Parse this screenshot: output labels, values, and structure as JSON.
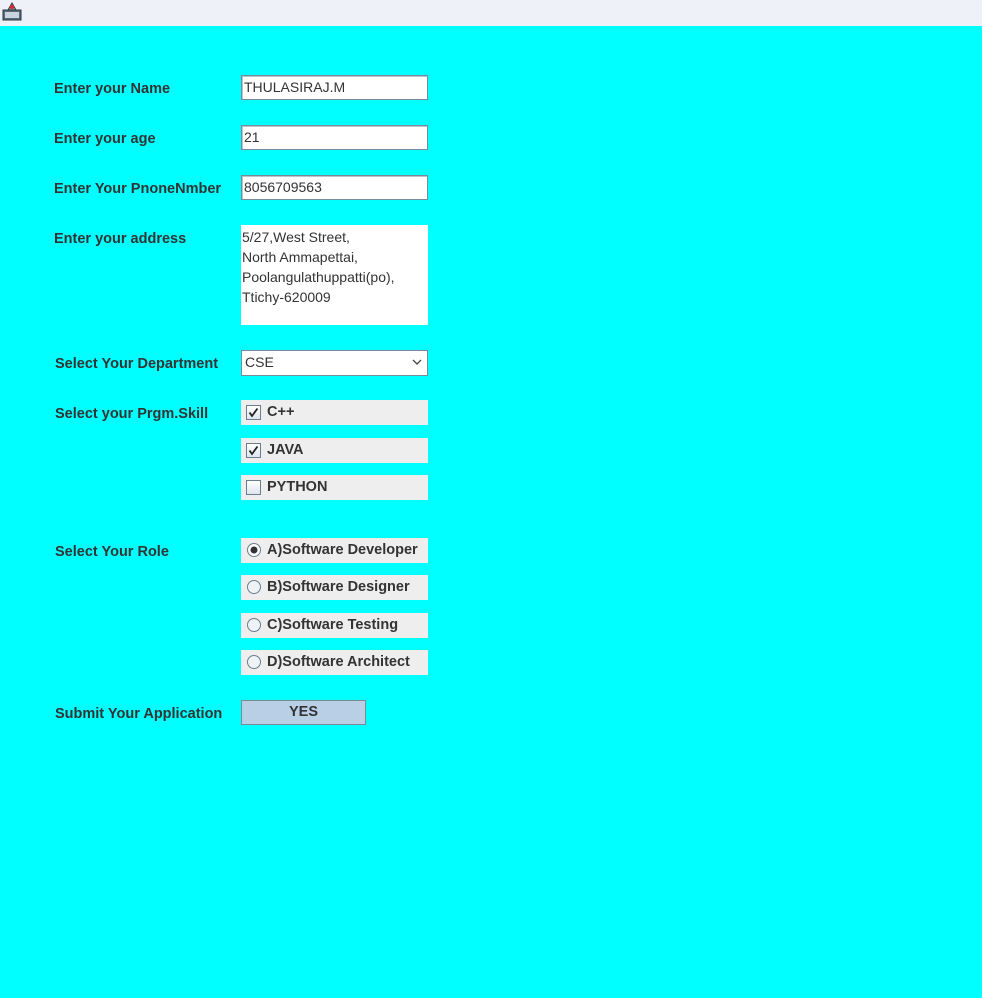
{
  "form": {
    "name": {
      "label": "Enter your Name",
      "value": "THULASIRAJ.M"
    },
    "age": {
      "label": "Enter your age",
      "value": "21"
    },
    "phone": {
      "label": "Enter Your PnoneNmber",
      "value": "8056709563"
    },
    "address": {
      "label": "Enter your address",
      "value": "5/27,West Street,\nNorth Ammapettai,\nPoolangulathuppatti(po),\nTtichy-620009"
    },
    "department": {
      "label": "Select Your Department",
      "value": "CSE"
    },
    "skills": {
      "label": "Select your Prgm.Skill",
      "options": [
        {
          "label": "C++",
          "checked": true
        },
        {
          "label": "JAVA",
          "checked": true
        },
        {
          "label": "PYTHON",
          "checked": false
        }
      ]
    },
    "role": {
      "label": "Select Your Role",
      "options": [
        {
          "label": "A)Software Developer",
          "selected": true
        },
        {
          "label": "B)Software Designer",
          "selected": false
        },
        {
          "label": "C)Software Testing",
          "selected": false
        },
        {
          "label": "D)Software Architect",
          "selected": false
        }
      ]
    },
    "submit": {
      "label": "Submit Your Application",
      "button": "YES"
    }
  },
  "icons": {
    "app": "java-app-icon",
    "dropdown": "chevron-down-icon",
    "check": "check-icon"
  },
  "colors": {
    "background": "#00ffff",
    "titlebar": "#eef1f7",
    "button": "#b8cfe5",
    "option_row": "#eeeeee"
  }
}
